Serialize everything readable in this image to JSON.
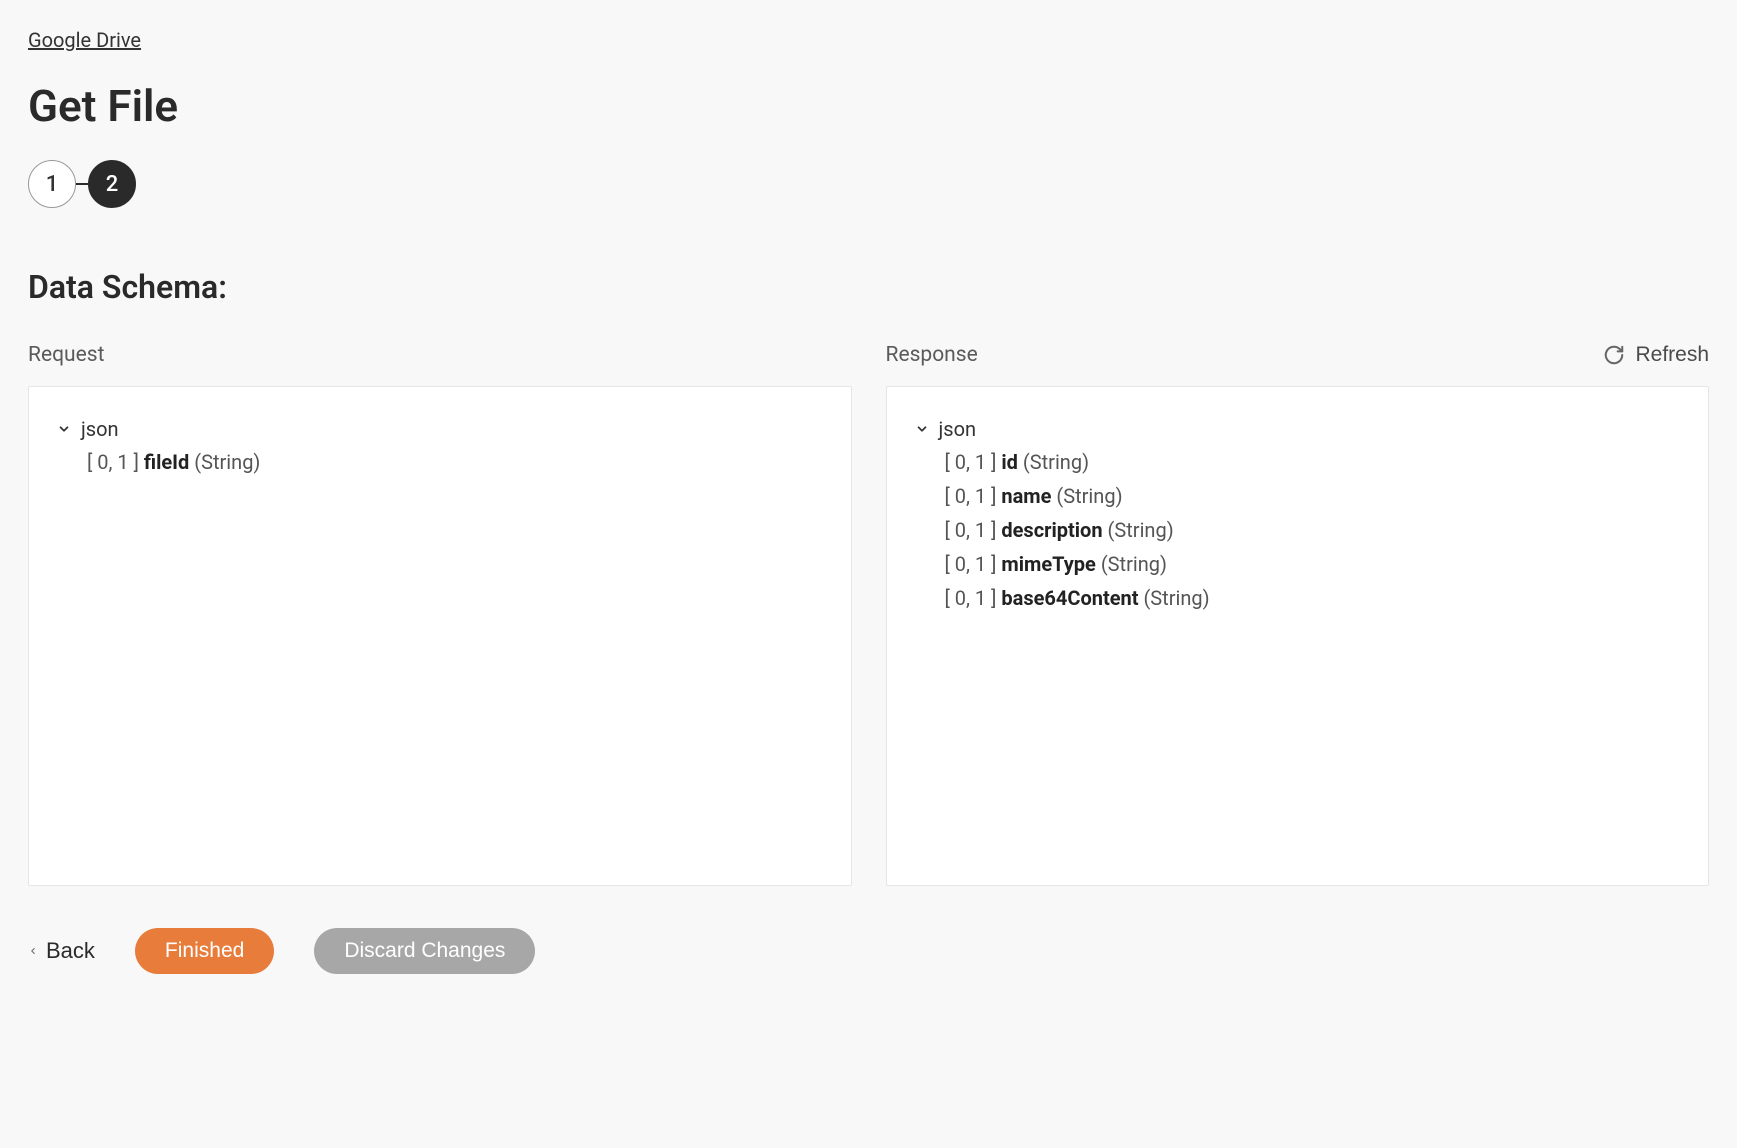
{
  "breadcrumb": {
    "label": "Google Drive"
  },
  "page": {
    "title": "Get File"
  },
  "stepper": {
    "step1": "1",
    "step2": "2"
  },
  "section": {
    "heading": "Data Schema:"
  },
  "request": {
    "label": "Request",
    "root": "json",
    "fields": [
      {
        "cardinality": "[ 0, 1 ]",
        "name": "fileId",
        "type": "(String)"
      }
    ]
  },
  "response": {
    "label": "Response",
    "root": "json",
    "fields": [
      {
        "cardinality": "[ 0, 1 ]",
        "name": "id",
        "type": "(String)"
      },
      {
        "cardinality": "[ 0, 1 ]",
        "name": "name",
        "type": "(String)"
      },
      {
        "cardinality": "[ 0, 1 ]",
        "name": "description",
        "type": "(String)"
      },
      {
        "cardinality": "[ 0, 1 ]",
        "name": "mimeType",
        "type": "(String)"
      },
      {
        "cardinality": "[ 0, 1 ]",
        "name": "base64Content",
        "type": "(String)"
      }
    ]
  },
  "actions": {
    "refresh": "Refresh",
    "back": "Back",
    "finished": "Finished",
    "discard": "Discard Changes"
  }
}
